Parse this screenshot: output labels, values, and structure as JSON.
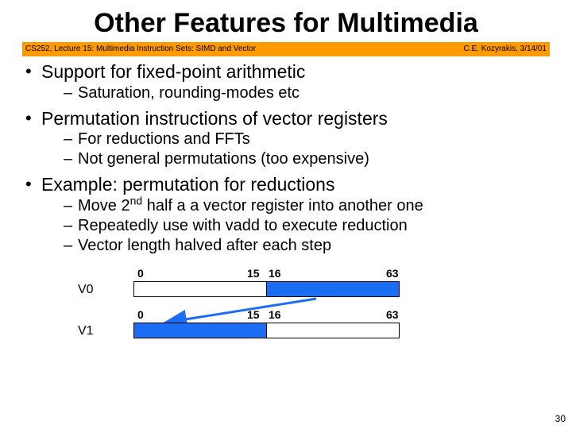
{
  "title": "Other Features for Multimedia",
  "banner": {
    "left": "CS252, Lecture 15: Multimedia Instruction Sets: SIMD and Vector",
    "right": "C.E. Kozyrakis, 3/14/01"
  },
  "bullets": {
    "b1": "Support for fixed-point arithmetic",
    "b1s1": "Saturation, rounding-modes etc",
    "b2": "Permutation instructions of vector registers",
    "b2s1": "For reductions and FFTs",
    "b2s2": "Not general permutations (too expensive)",
    "b3": "Example: permutation for reductions",
    "b3s1_pre": "Move 2",
    "b3s1_sup": "nd",
    "b3s1_post": " half a a vector register into another one",
    "b3s2": "Repeatedly use with vadd to execute reduction",
    "b3s3": "Vector length halved after each step"
  },
  "diagram": {
    "v0": "V0",
    "v1": "V1",
    "t0a": "0",
    "t15a": "15",
    "t16a": "16",
    "t63a": "63",
    "t0b": "0",
    "t15b": "15",
    "t16b": "16",
    "t63b": "63"
  },
  "pagenum": "30"
}
